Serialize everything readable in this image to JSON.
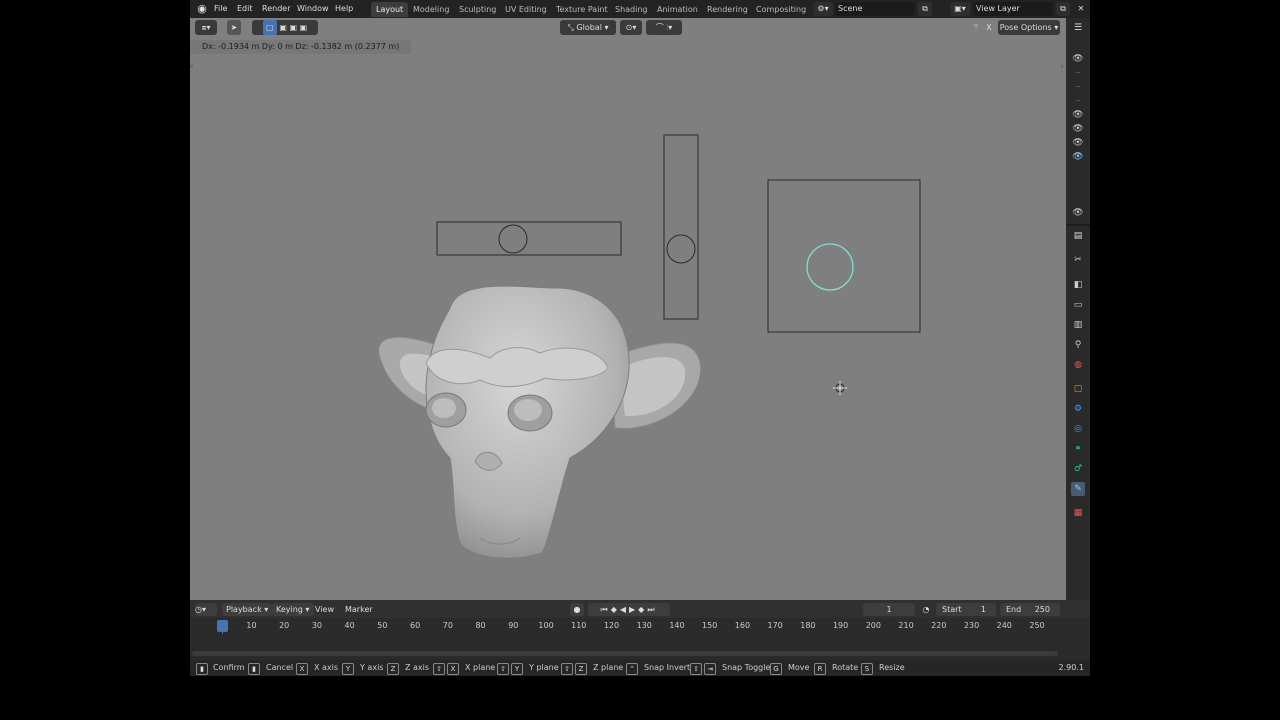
{
  "menu": {
    "file": "File",
    "edit": "Edit",
    "render": "Render",
    "window": "Window",
    "help": "Help"
  },
  "workspaces": [
    "Layout",
    "Modeling",
    "Sculpting",
    "UV Editing",
    "Texture Paint",
    "Shading",
    "Animation",
    "Rendering",
    "Compositing"
  ],
  "scene": {
    "name": "Scene"
  },
  "view_layer": {
    "name": "View Layer"
  },
  "viewport": {
    "transform_orientation": "Global",
    "pose_options": "Pose Options",
    "x_label": "X",
    "operator_status": "Dx: -0.1934 m   Dy: 0 m   Dz: -0.1382 m (0.2377 m)"
  },
  "timeline": {
    "playback": "Playback",
    "keying": "Keying",
    "view": "View",
    "marker": "Marker",
    "current_frame": "1",
    "start_label": "Start",
    "start": "1",
    "end_label": "End",
    "end": "250",
    "ticks": [
      "1",
      "10",
      "20",
      "30",
      "40",
      "50",
      "60",
      "70",
      "80",
      "90",
      "100",
      "110",
      "120",
      "130",
      "140",
      "150",
      "160",
      "170",
      "180",
      "190",
      "200",
      "210",
      "220",
      "230",
      "240",
      "250"
    ]
  },
  "statusbar": {
    "confirm": "Confirm",
    "cancel": "Cancel",
    "x_axis": "X axis",
    "y_axis": "Y axis",
    "z_axis": "Z axis",
    "x_plane": "X plane",
    "y_plane": "Y plane",
    "z_plane": "Z plane",
    "snap_invert": "Snap Invert",
    "snap_toggle": "Snap Toggle",
    "move": "Move",
    "rotate": "Rotate",
    "resize": "Resize",
    "key_x": "X",
    "key_y": "Y",
    "key_z": "Z",
    "key_g": "G",
    "key_r": "R",
    "key_s": "S",
    "version": "2.90.1"
  },
  "colors": {
    "accent": "#4772b3",
    "selection": "#7fe0d6"
  }
}
